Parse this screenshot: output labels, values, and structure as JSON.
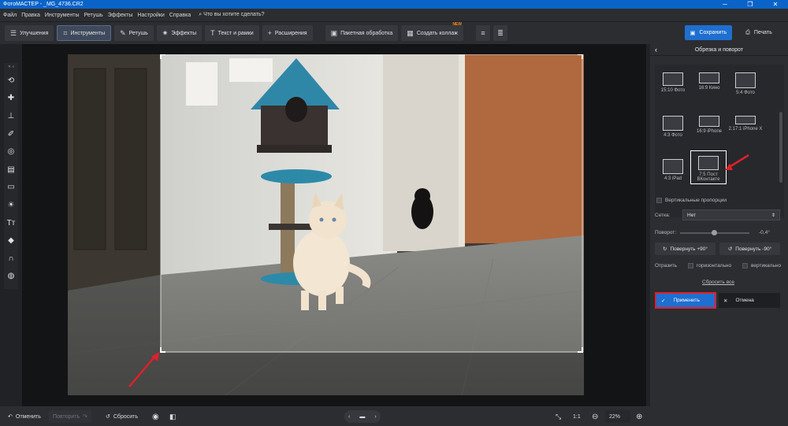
{
  "window": {
    "title": "ФотоМАСТЕР - _MG_4736.CR2",
    "minimize": "─",
    "maximize": "❐",
    "close": "✕"
  },
  "menu": {
    "items": [
      "Файл",
      "Правка",
      "Инструменты",
      "Ретушь",
      "Эффекты",
      "Настройки",
      "Справка"
    ],
    "search_placeholder": "Что вы хотите сделать?"
  },
  "toolbar": {
    "tabs": [
      {
        "label": "Улучшения",
        "icon": "sliders-icon"
      },
      {
        "label": "Инструменты",
        "icon": "crop-icon",
        "active": true
      },
      {
        "label": "Ретушь",
        "icon": "brush-icon"
      },
      {
        "label": "Эффекты",
        "icon": "sparkle-icon"
      },
      {
        "label": "Текст и рамки",
        "icon": "text-icon"
      },
      {
        "label": "Расширения",
        "icon": "plus-icon"
      }
    ],
    "batch_label": "Пакетная обработка",
    "collage_label": "Создать коллаж",
    "collage_badge": "NEW",
    "save_label": "Сохранить",
    "print_label": "Печать"
  },
  "left_tools": [
    "rotate-icon",
    "bandage-icon",
    "stamp-icon",
    "brush-icon",
    "radial-icon",
    "gradient-icon",
    "vignette-icon",
    "sun-icon",
    "text-icon",
    "fill-icon",
    "magnet-icon",
    "globe-icon"
  ],
  "panel": {
    "title": "Обрезка и поворот",
    "presets": [
      {
        "label": "15:10 Фото"
      },
      {
        "label": "16:9 Кино"
      },
      {
        "label": "5:4 Фото"
      },
      {
        "label": "4:3 Фото"
      },
      {
        "label": "16:9 iPhone"
      },
      {
        "label": "2.17:1 iPhone X"
      },
      {
        "label": "4:3 iPad"
      },
      {
        "label": "7:5 Пост ВКонтакте",
        "selected": true
      }
    ],
    "vertical_proportions": "Вертикальные пропорции",
    "grid_label": "Сетка:",
    "grid_value": "Нет",
    "rotation_label": "Поворот:",
    "rotation_value": "-0,4°",
    "rotate_plus": "Повернуть +90°",
    "rotate_minus": "Повернуть -90°",
    "flip_label": "Отразить",
    "flip_horizontal": "горизонтально",
    "flip_vertical": "вертикально",
    "reset_all": "Сбросить все",
    "apply": "Применить",
    "cancel": "Отмена"
  },
  "bottom": {
    "undo": "Отменить",
    "redo": "Повторить",
    "reset": "Сбросить",
    "zoom_ratio": "1:1",
    "zoom_value": "22%"
  },
  "colors": {
    "accent": "#1e6fd0",
    "highlight": "#e0202a"
  }
}
